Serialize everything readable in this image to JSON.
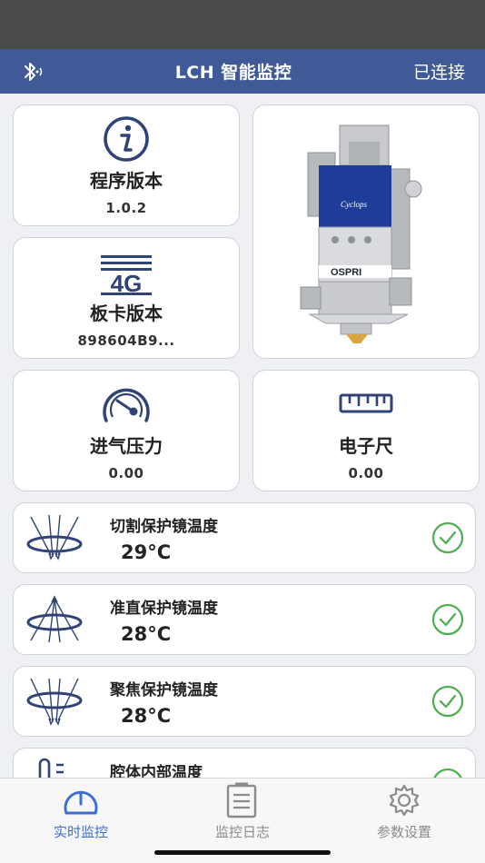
{
  "header": {
    "title": "LCH 智能监控",
    "connection_status": "已连接",
    "bluetooth_icon": "bluetooth-icon"
  },
  "tiles": {
    "firmware": {
      "title": "程序版本",
      "value": "1.0.2",
      "icon": "info-icon"
    },
    "board": {
      "title": "板卡版本",
      "value": "898604B9...",
      "icon": "4g-icon",
      "icon_text": "4G"
    },
    "pressure": {
      "title": "进气压力",
      "value": "0.00",
      "icon": "gauge-icon"
    },
    "ruler": {
      "title": "电子尺",
      "value": "0.00",
      "icon": "ruler-icon"
    }
  },
  "product": {
    "brand_text": "Cyclops",
    "logo_text": "OSPRI",
    "image": "laser-head-image"
  },
  "sensors": [
    {
      "label": "切割保护镜温度",
      "value": "29°C",
      "icon": "cutting-lens-icon",
      "status": "ok"
    },
    {
      "label": "准直保护镜温度",
      "value": "28°C",
      "icon": "collimating-lens-icon",
      "status": "ok"
    },
    {
      "label": "聚焦保护镜温度",
      "value": "28°C",
      "icon": "focusing-lens-icon",
      "status": "ok"
    },
    {
      "label": "腔体内部温度",
      "value": "",
      "icon": "thermometer-icon",
      "status": "ok"
    }
  ],
  "tabs": [
    {
      "label": "实时监控",
      "icon": "monitor-gauge-icon",
      "active": true
    },
    {
      "label": "监控日志",
      "icon": "log-icon",
      "active": false
    },
    {
      "label": "参数设置",
      "icon": "gear-icon",
      "active": false
    }
  ],
  "colors": {
    "nav_bg": "#3f5a96",
    "icon_blue": "#2f4377",
    "check_green": "#4cae4f",
    "tab_active": "#3b6fd6"
  }
}
